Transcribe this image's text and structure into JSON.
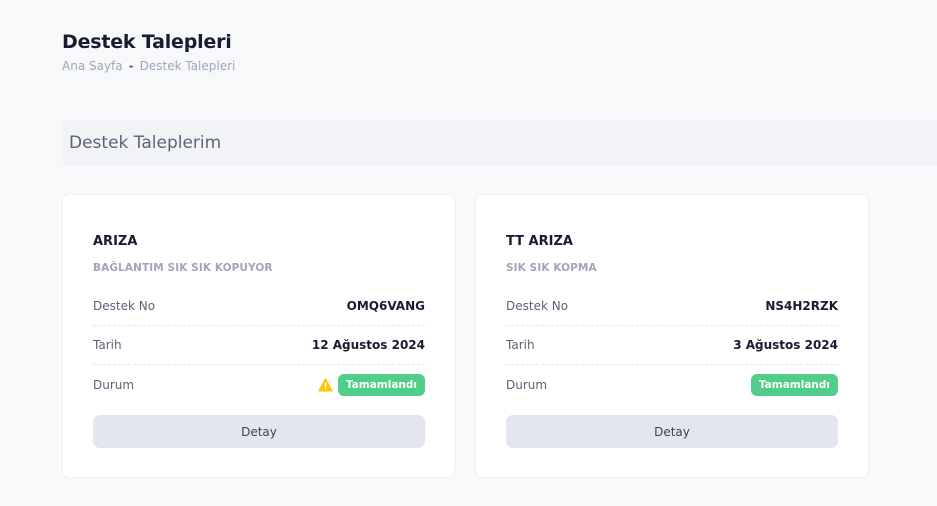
{
  "header": {
    "title": "Destek Talepleri",
    "breadcrumb": [
      "Ana Sayfa",
      "Destek Talepleri"
    ],
    "breadcrumb_separator": "-"
  },
  "section": {
    "title": "Destek Taleplerim"
  },
  "tickets": [
    {
      "title": "ARIZA",
      "subtitle": "BAĞLANTIM SIK SIK KOPUYOR",
      "no_label": "Destek No",
      "no_value": "OMQ6VANG",
      "date_label": "Tarih",
      "date_value": "12 Ağustos 2024",
      "status_label": "Durum",
      "status_value": "Tamamlandı",
      "has_warning_icon": true,
      "button_label": "Detay"
    },
    {
      "title": "TT ARIZA",
      "subtitle": "SIK SIK KOPMA",
      "no_label": "Destek No",
      "no_value": "NS4H2RZK",
      "date_label": "Tarih",
      "date_value": "3 Ağustos 2024",
      "status_label": "Durum",
      "status_value": "Tamamlandı",
      "has_warning_icon": false,
      "button_label": "Detay"
    }
  ],
  "colors": {
    "status_success": "#50cd89",
    "warning": "#ffc700",
    "button_bg": "#e4e6ef"
  }
}
